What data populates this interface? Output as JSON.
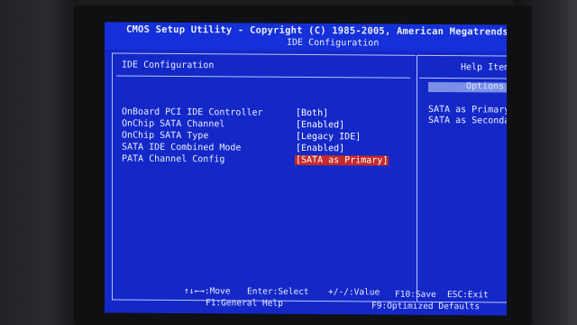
{
  "header": {
    "title": "CMOS Setup Utility - Copyright (C) 1985-2005, American Megatrends,",
    "subtitle": "IDE Configuration"
  },
  "main": {
    "section_title": "IDE Configuration",
    "settings": [
      {
        "label": "OnBoard PCI IDE Controller",
        "value": "[Both]",
        "selected": false
      },
      {
        "label": "OnChip SATA Channel",
        "value": "[Enabled]",
        "selected": false
      },
      {
        "label": "OnChip SATA Type",
        "value": "[Legacy IDE]",
        "selected": false
      },
      {
        "label": "SATA IDE Combined Mode",
        "value": "[Enabled]",
        "selected": false
      },
      {
        "label": "PATA Channel Config",
        "value": "[SATA as Primary]",
        "selected": true
      }
    ]
  },
  "help": {
    "title": "Help Item",
    "options_label": "Options",
    "options": [
      "SATA as Primary",
      "SATA as Secondary"
    ]
  },
  "footer": {
    "navigate": "↑↓←→:Move",
    "enter": "Enter:Select",
    "value": "+/-/:Value",
    "save": "F10:Save",
    "exit": "ESC:Exit",
    "general_help": "F1:General Help",
    "defaults": "F9:Optimized Defaults"
  },
  "colors": {
    "screen_bg": "#1428c8",
    "highlight": "#c42a2a",
    "text": "#e8edff"
  }
}
